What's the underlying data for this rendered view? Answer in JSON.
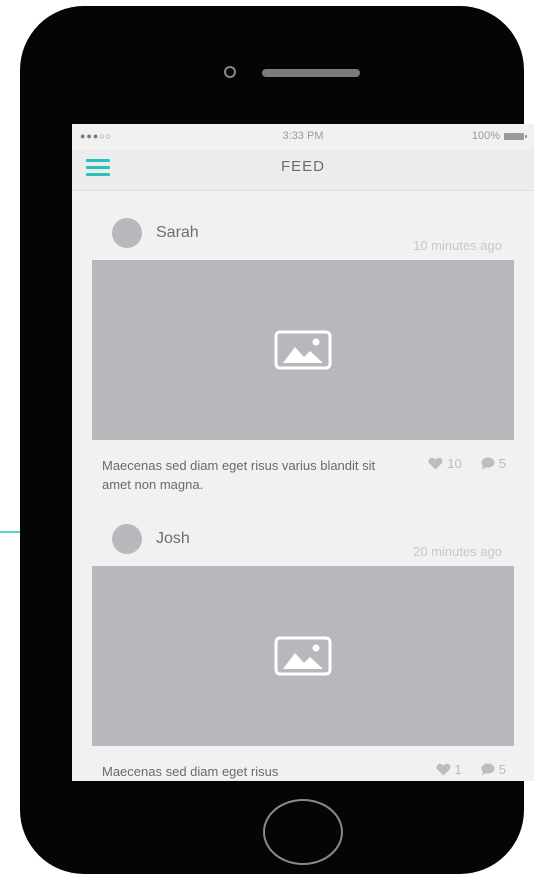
{
  "status_bar": {
    "signal": "●●●○○",
    "time": "3:33 PM",
    "battery": "100%"
  },
  "nav": {
    "title": "FEED",
    "menu_icon": "hamburger-menu-icon"
  },
  "posts": [
    {
      "author": "Sarah",
      "time_ago": "10 minutes ago",
      "caption": "Maecenas sed diam eget risus varius blandit sit amet non magna.",
      "likes": "10",
      "comments": "5"
    },
    {
      "author": "Josh",
      "time_ago": "20 minutes ago",
      "caption": "Maecenas sed diam eget risus",
      "likes": "1",
      "comments": "5"
    }
  ],
  "colors": {
    "accent": "#2bbfbd",
    "phone_body": "#050505",
    "screen_bg": "#f1f1f1",
    "placeholder": "#b8b8bc"
  }
}
